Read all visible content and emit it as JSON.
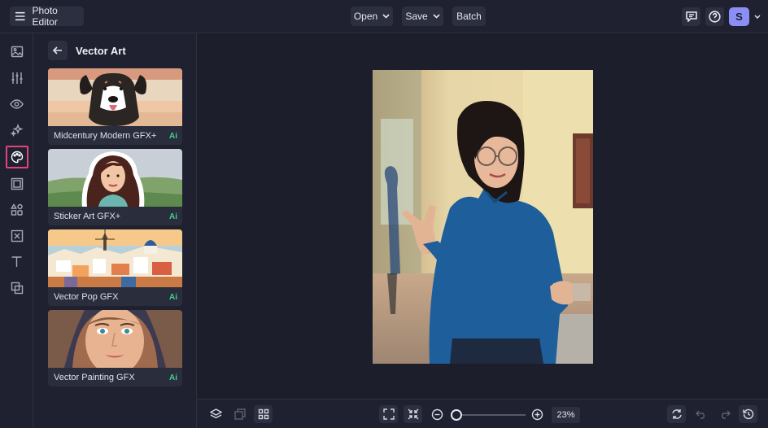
{
  "app": {
    "title": "Photo Editor"
  },
  "toolbar": {
    "open_label": "Open",
    "save_label": "Save",
    "batch_label": "Batch",
    "user_initial": "S"
  },
  "panel": {
    "title": "Vector Art",
    "cards": [
      {
        "label": "Midcentury Modern GFX+",
        "badge": "Ai"
      },
      {
        "label": "Sticker Art GFX+",
        "badge": "Ai"
      },
      {
        "label": "Vector Pop GFX",
        "badge": "Ai"
      },
      {
        "label": "Vector Painting GFX",
        "badge": "Ai"
      }
    ]
  },
  "rail": {
    "items": [
      "image-icon",
      "adjust-sliders-icon",
      "eye-icon",
      "effects-sparkle-icon",
      "artsy-palette-icon",
      "frame-icon",
      "graphics-shapes-icon",
      "texture-icon",
      "text-icon",
      "overlay-icon"
    ],
    "active": "artsy-palette-icon"
  },
  "zoom": {
    "value": "23%"
  },
  "colors": {
    "accent_active": "#e0447c",
    "ai_badge": "#44d18c",
    "avatar": "#8b8ff5"
  }
}
